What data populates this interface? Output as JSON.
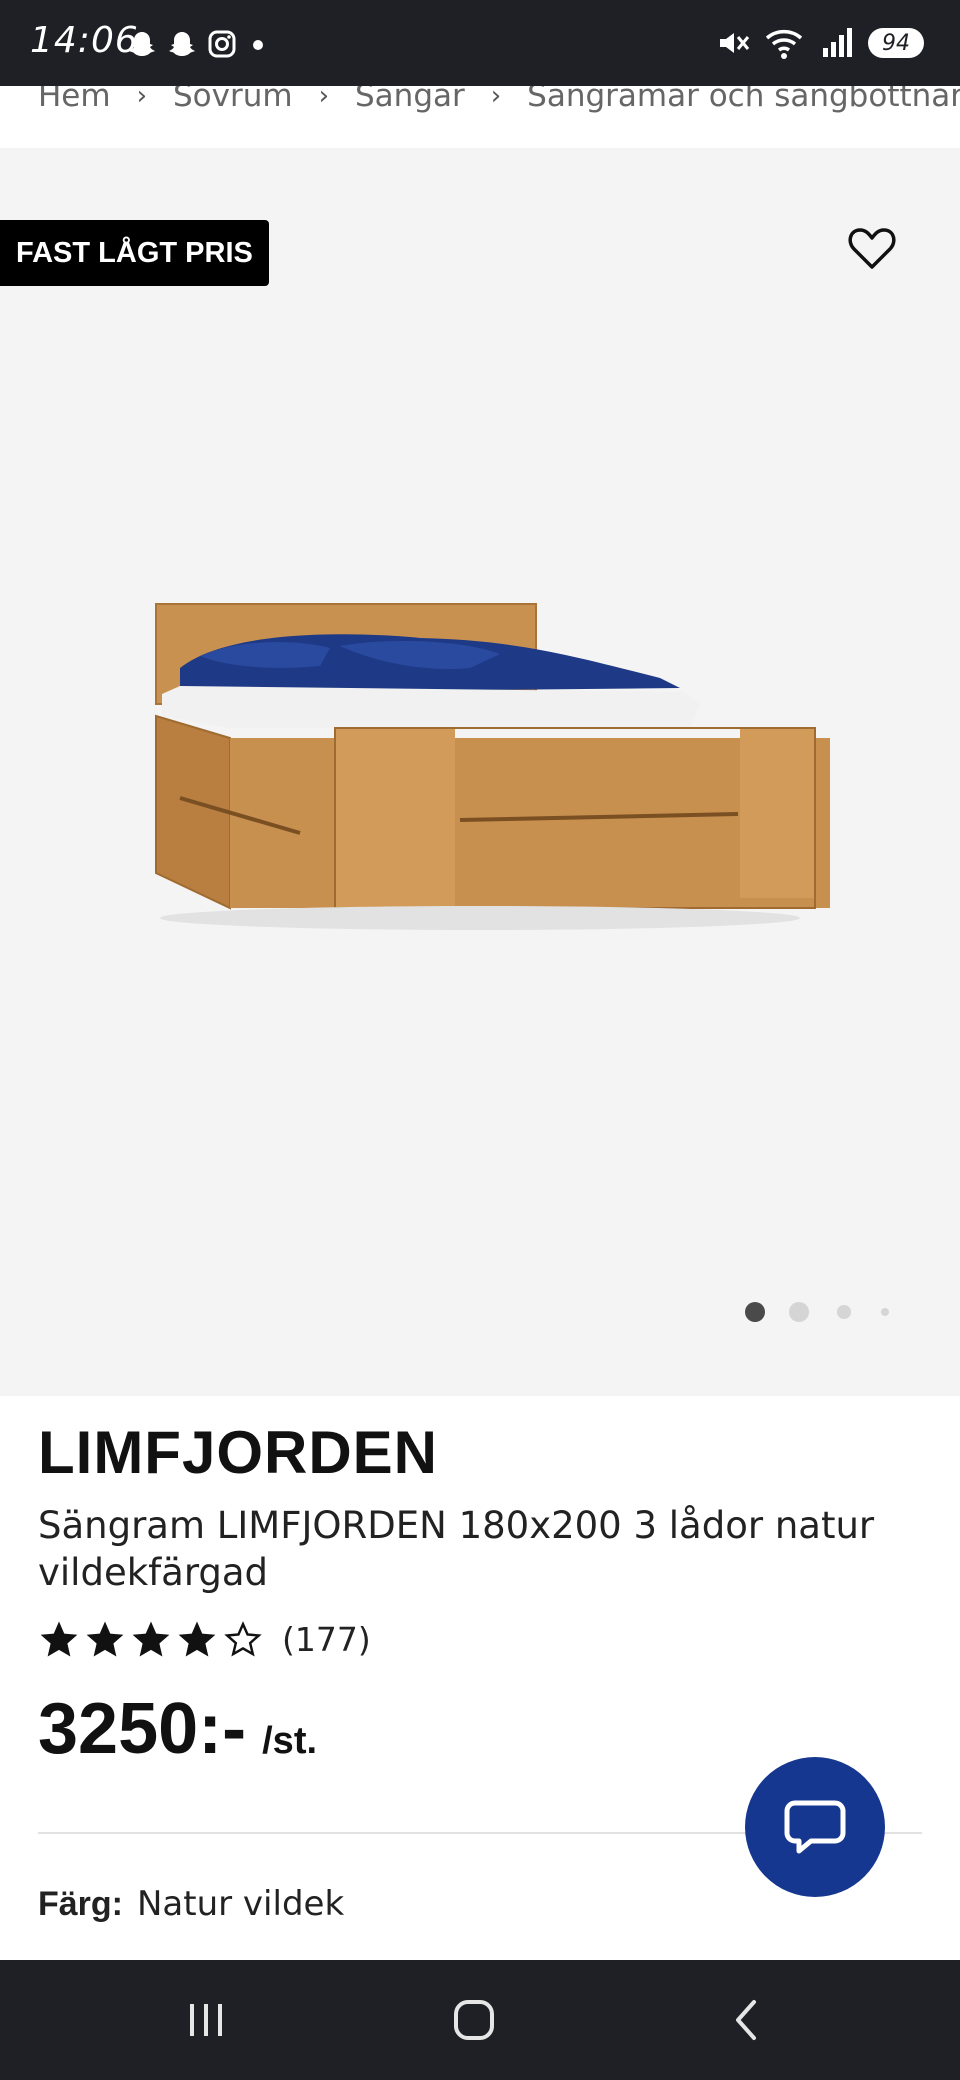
{
  "status_bar": {
    "time": "14:06",
    "battery": "94",
    "left_icons": [
      "snapchat-icon",
      "snapchat-icon",
      "instagram-icon",
      "dot-icon"
    ],
    "right_icons": [
      "mute-icon",
      "wifi-icon",
      "signal-icon",
      "battery-icon"
    ]
  },
  "breadcrumb": {
    "items": [
      "Hem",
      "Sovrum",
      "Sängar",
      "Sängramar och sängbottnar"
    ]
  },
  "product": {
    "badge": "FAST LÅGT PRIS",
    "brand": "LIMFJORDEN",
    "name": "Sängram LIMFJORDEN 180x200 3 lådor natur vildekfärgad",
    "rating_stars": 4,
    "rating_max": 5,
    "rating_count": "(177)",
    "price": "3250:-",
    "price_unit": "/st.",
    "color_label": "Färg:",
    "color_value": "Natur vildek"
  },
  "gallery": {
    "active_index": 0,
    "count": 4
  },
  "colors": {
    "accent_blue": "#16378f",
    "badge_bg": "#000000",
    "image_bg": "#f4f4f4",
    "system_bar": "#1f2026"
  },
  "nav": {
    "buttons": [
      "recent-apps-icon",
      "home-icon",
      "back-icon"
    ]
  }
}
